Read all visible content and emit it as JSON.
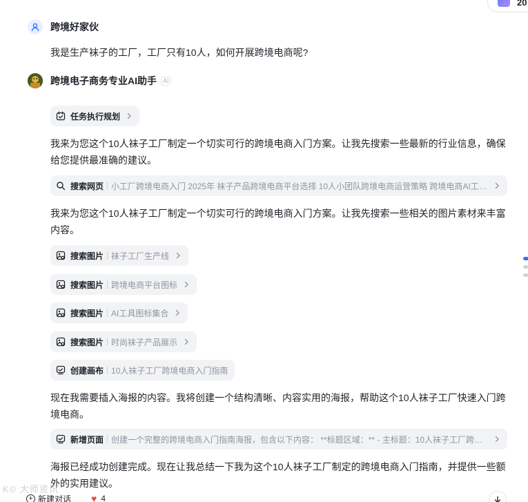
{
  "top_chip": {
    "text": "20"
  },
  "user": {
    "name": "跨境好家伙",
    "message": "我是生产袜子的工厂，工厂只有10人，如何开展跨境电商呢?"
  },
  "assistant": {
    "name": "跨境电子商务专业AI助手",
    "badge": "AI"
  },
  "steps": {
    "plan": {
      "title": "任务执行规划"
    },
    "para1": "我来为您这个10人袜子工厂制定一个切实可行的跨境电商入门方案。让我先搜索一些最新的行业信息，确保给您提供最准确的建议。",
    "web_search": {
      "title": "搜索网页",
      "desc": "小工厂跨境电商入门 2025年 袜子产品跨境电商平台选择 10人小团队跨境电商运营策略 跨境电商AI工具..."
    },
    "para2": "我来为您这个10人袜子工厂制定一个切实可行的跨境电商入门方案。让我先搜索一些相关的图片素材来丰富内容。",
    "img1": {
      "title": "搜索图片",
      "desc": "袜子工厂生产线"
    },
    "img2": {
      "title": "搜索图片",
      "desc": "跨境电商平台图标"
    },
    "img3": {
      "title": "搜索图片",
      "desc": "AI工具图标集合"
    },
    "img4": {
      "title": "搜索图片",
      "desc": "时尚袜子产品展示"
    },
    "canvas": {
      "title": "创建画布",
      "desc": "10人袜子工厂跨境电商入门指南"
    },
    "para3": "现在我需要插入海报的内容。我将创建一个结构清晰、内容实用的海报，帮助这个10人袜子工厂快速入门跨境电商。",
    "new_page": {
      "title": "新增页面",
      "desc": "创建一个完整的跨境电商入门指南海报，包含以下内容： **标题区域：** - 主标题：10人袜子工厂跨境..."
    },
    "para4": "海报已经成功创建完成。现在让我总结一下我为这个10人袜子工厂制定的跨境电商入门指南，并提供一些额外的实用建议。"
  },
  "bottom": {
    "watermark": "K© 大师资讯",
    "new_chat": "新建对话",
    "likes": "4"
  },
  "icons": {
    "user_avatar": "person-icon",
    "plan": "calendar-icon",
    "web_search": "search-icon",
    "image_search": "image-search-icon",
    "canvas": "canvas-icon",
    "new_page": "new-page-icon",
    "chevron": "chevron-right-icon",
    "heart": "heart-icon",
    "scroll_down": "arrow-down-icon"
  },
  "colors": {
    "accent": "#3370ff",
    "pill_bg": "#f2f3f5",
    "muted_text": "#8f959e",
    "heart": "#e84a4a"
  }
}
